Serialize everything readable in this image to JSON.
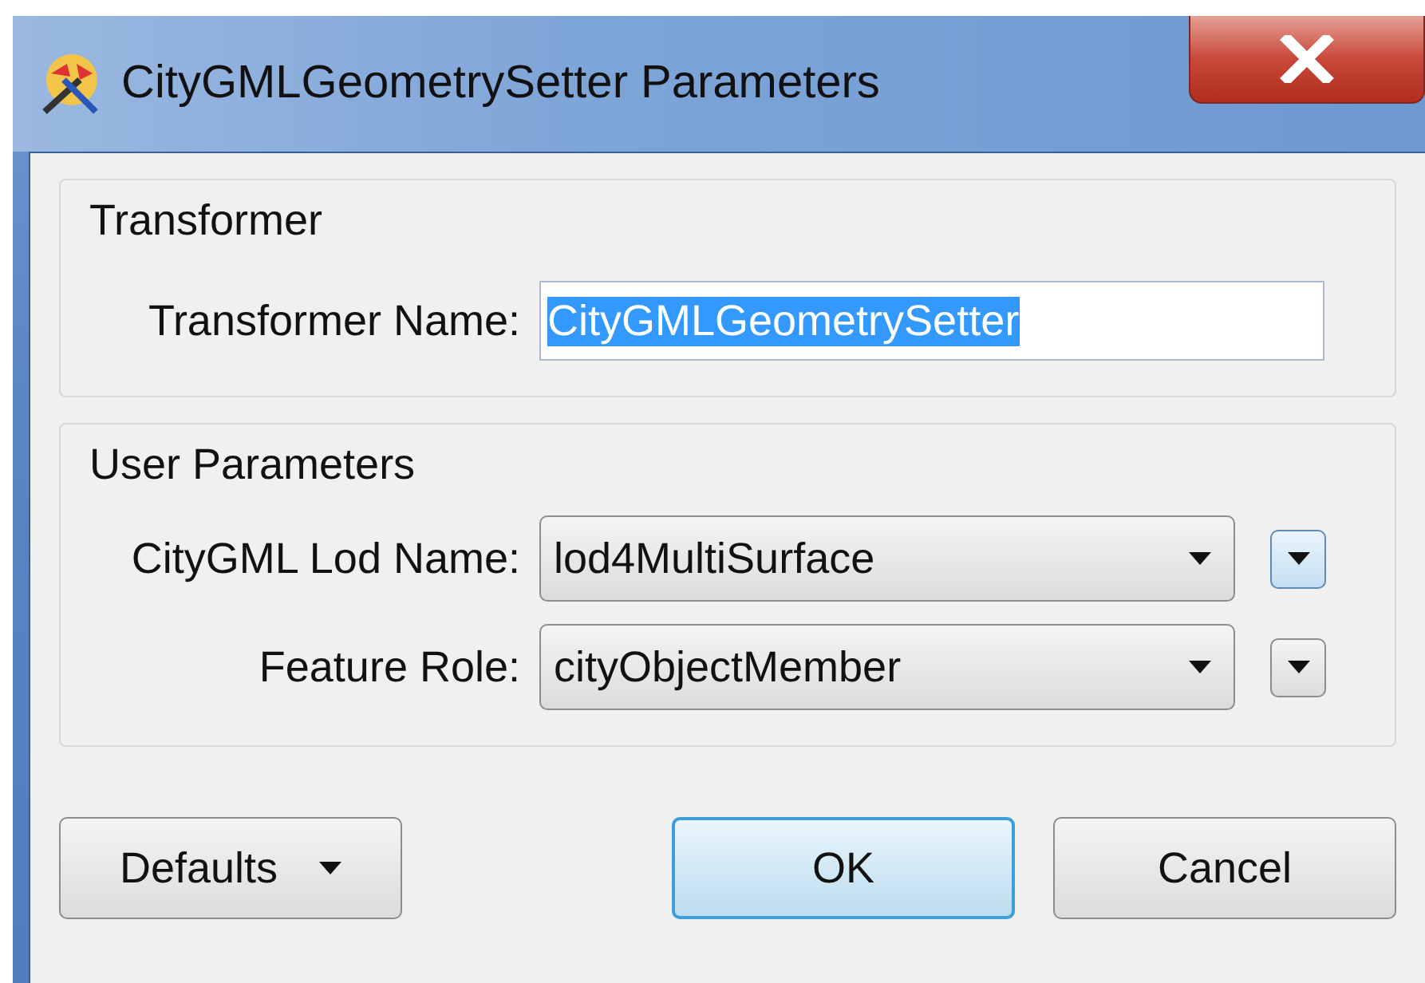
{
  "window": {
    "title": "CityGMLGeometrySetter Parameters"
  },
  "groups": [
    {
      "title": "Transformer",
      "fields": [
        {
          "kind": "text",
          "label": "Transformer Name:",
          "value": "CityGMLGeometrySetter",
          "text_selected": true
        }
      ]
    },
    {
      "title": "User Parameters",
      "fields": [
        {
          "kind": "combo",
          "label": "CityGML Lod Name:",
          "value": "lod4MultiSurface",
          "menu_highlighted": true
        },
        {
          "kind": "combo",
          "label": "Feature Role:",
          "value": "cityObjectMember",
          "menu_highlighted": false
        }
      ]
    }
  ],
  "buttons": [
    {
      "kind": "menu",
      "label": "Defaults",
      "default": false
    },
    {
      "kind": "push",
      "label": "OK",
      "default": true
    },
    {
      "kind": "push",
      "label": "Cancel",
      "default": false
    }
  ]
}
